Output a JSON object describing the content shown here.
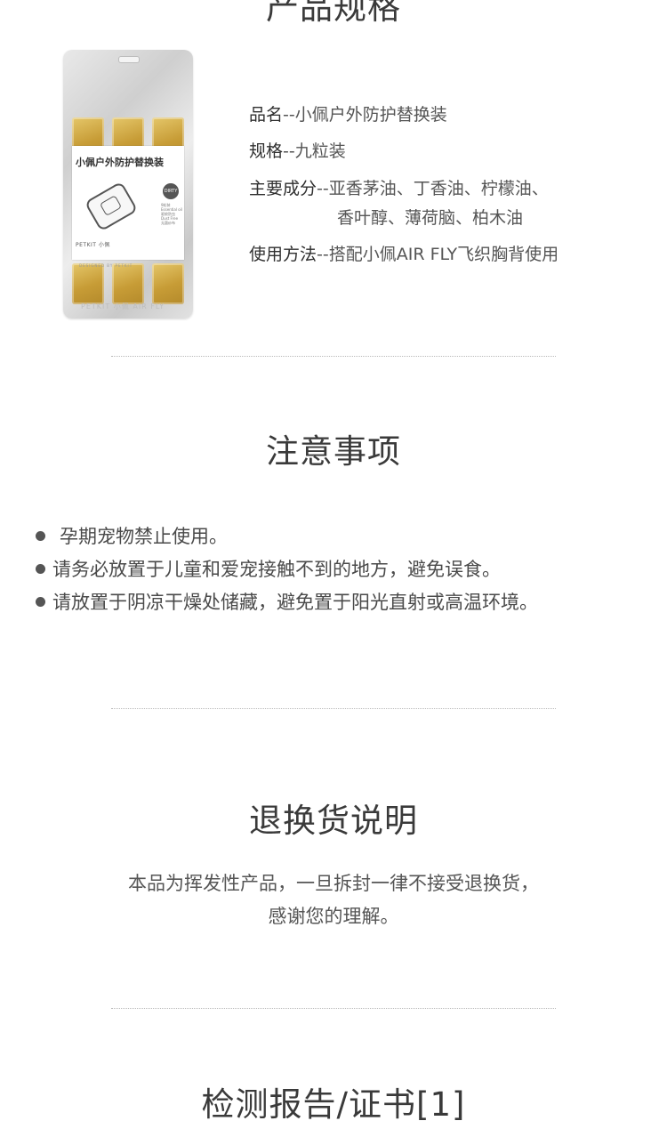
{
  "spec_section": {
    "title": "产品规格",
    "package": {
      "name": "小佩户外防护替换装",
      "brand": "PETKIT 小佩",
      "badge": "DIRTY FREE",
      "small_text": "9粒装 Essential oil 驱蚊防虫 Dust Free 无菌纱布",
      "footer": "DESIGNED BY PETKIT",
      "bottom_text": "PETKIT 小佩 AIR FLY"
    },
    "items": [
      {
        "key": "品名",
        "value": "--小佩户外防护替换装"
      },
      {
        "key": "规格",
        "value": "--九粒装"
      },
      {
        "key": "主要成分",
        "value": "--亚香茅油、丁香油、柠檬油、",
        "cont": "香叶醇、薄荷脑、柏木油"
      },
      {
        "key": "使用方法",
        "value": "--搭配小佩AIR FLY飞织胸背使用"
      }
    ]
  },
  "notes_section": {
    "title": "注意事项",
    "items": [
      "孕期宠物禁止使用。",
      "请务必放置于儿童和爱宠接触不到的地方，避免误食。",
      "请放置于阴凉干燥处储藏，避免置于阳光直射或高温环境。"
    ]
  },
  "returns_section": {
    "title": "退换货说明",
    "lines": [
      "本品为挥发性产品，一旦拆封一律不接受退换货，",
      "感谢您的理解。"
    ]
  },
  "report_section": {
    "title": "检测报告/证书[1]"
  }
}
